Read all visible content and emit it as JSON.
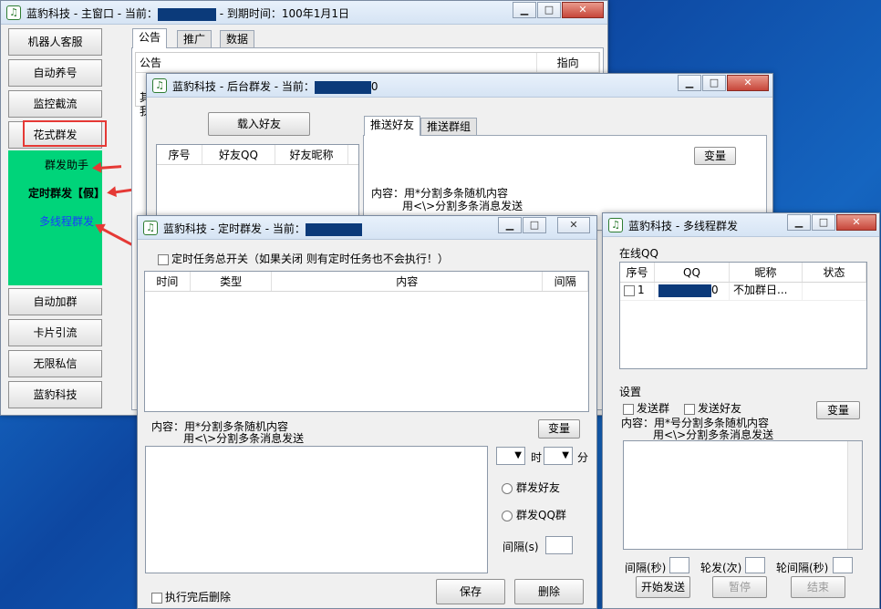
{
  "main": {
    "title_prefix": "蓝豹科技 - 主窗口 - 当前：",
    "title_suffix": " - 到期时间：100年1月1日",
    "sidebar": [
      "机器人客服",
      "自动养号",
      "监控截流",
      "花式群发"
    ],
    "sub": [
      "群发助手",
      "定时群发【假】",
      "多线程群发"
    ],
    "sidebar2": [
      "自动加群",
      "卡片引流",
      "无限私信",
      "蓝豹科技"
    ],
    "tabs": [
      "公告",
      "推广",
      "数据"
    ],
    "table_headers": [
      "公告",
      "指向"
    ],
    "row_fragments": [
      "其",
      "我"
    ]
  },
  "backend": {
    "title_prefix": "蓝豹科技 - 后台群发 - 当前：",
    "title_suffix": "0",
    "load_button": "载入好友",
    "tabs": [
      "推送好友",
      "推送群组"
    ],
    "columns": [
      "序号",
      "好友QQ",
      "好友昵称"
    ],
    "variable_button": "变量",
    "content_line1": "内容：用*分割多条随机内容",
    "content_line2": "用<\\>分割多条消息发送"
  },
  "timed": {
    "title": "蓝豹科技 - 定时群发 - 当前：",
    "master_switch": "定时任务总开关（如果关闭 则有定时任务也不会执行！）",
    "columns": [
      "时间",
      "类型",
      "内容",
      "间隔"
    ],
    "content_line1": "内容：用*分割多条随机内容",
    "content_line2": "用<\\>分割多条消息发送",
    "variable_button": "变量",
    "hour_label": "时",
    "minute_label": "分",
    "radio_friends": "群发好友",
    "radio_groups": "群发QQ群",
    "interval_label": "间隔(s)",
    "delete_after": "执行完后删除",
    "save_button": "保存",
    "delete_button": "删除"
  },
  "multi": {
    "title": "蓝豹科技 - 多线程群发",
    "online_label": "在线QQ",
    "columns": [
      "序号",
      "QQ",
      "昵称",
      "状态"
    ],
    "row": {
      "index": "1",
      "qq_suffix": "0",
      "nickname": "不加群日..."
    },
    "settings_label": "设置",
    "send_group": "发送群",
    "send_friend": "发送好友",
    "variable_button": "变量",
    "content_line1": "内容：用*号分割多条随机内容",
    "content_line2": "用<\\>分割多条消息发送",
    "interval": "间隔(秒)",
    "rounds": "轮发(次)",
    "round_interval": "轮间隔(秒)",
    "start": "开始发送",
    "pause": "暂停",
    "stop": "结束"
  },
  "colors": {
    "highlight_box": "#e53935",
    "submenu_bg": "#00d47a",
    "link_blue": "#1a3cff",
    "mask": "#0b3a7a"
  }
}
